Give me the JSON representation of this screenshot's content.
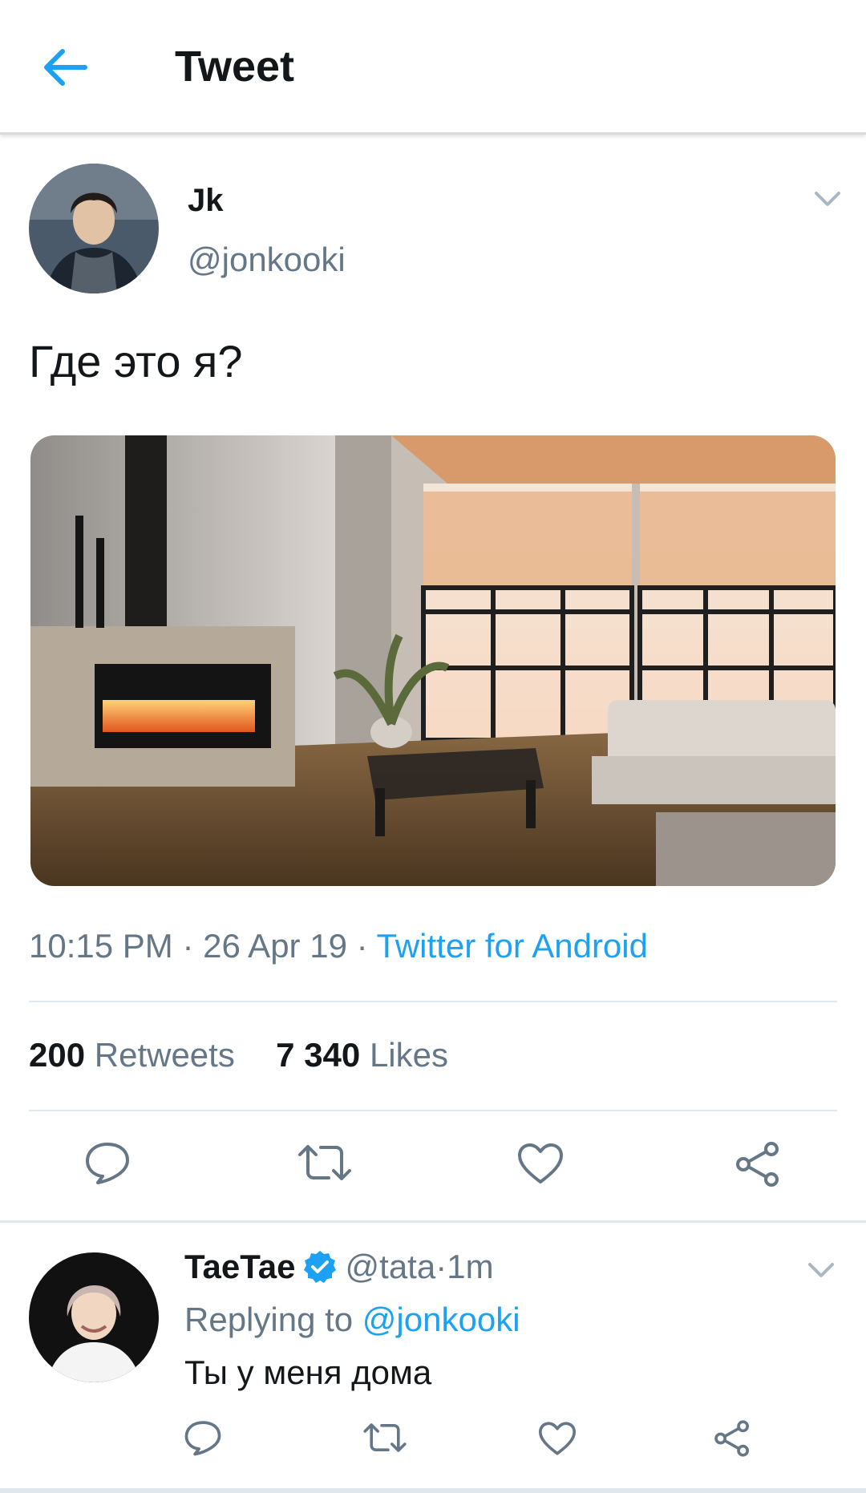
{
  "header": {
    "title": "Tweet",
    "back_icon": "arrow-left-icon"
  },
  "colors": {
    "accent": "#1da1f2",
    "secondary_text": "#657786",
    "primary_text": "#14171a"
  },
  "tweet": {
    "author_name": "Jk",
    "author_handle": "@jonkooki",
    "text": "Где это я?",
    "time": "10:15 PM",
    "date": "26 Apr 19",
    "separator": " · ",
    "source": "Twitter for Android",
    "retweets_count": "200",
    "retweets_label": "Retweets",
    "likes_count": "7 340",
    "likes_label": "Likes",
    "actions": [
      "reply-icon",
      "retweet-icon",
      "like-icon",
      "share-icon"
    ]
  },
  "reply": {
    "author_name": "TaeTae",
    "author_handle": "@tata",
    "time": "1m",
    "separator": " · ",
    "replying_prefix": "Replying to ",
    "replying_to": "@jonkooki",
    "text": "Ты у меня дома",
    "actions": [
      "reply-icon",
      "retweet-icon",
      "like-icon",
      "share-icon"
    ]
  }
}
